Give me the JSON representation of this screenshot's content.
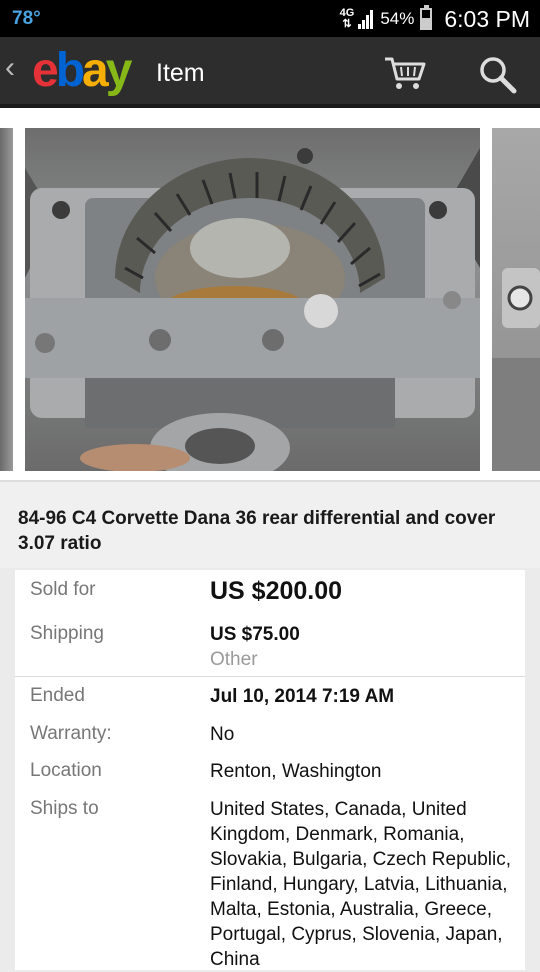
{
  "status_bar": {
    "temperature": "78°",
    "network": "4G",
    "battery_percent": "54%",
    "battery_level": 0.54,
    "time": "6:03 PM"
  },
  "app_bar": {
    "back_icon": "chevron-left-icon",
    "logo": "ebay",
    "title": "Item",
    "cart_icon": "cart-icon",
    "search_icon": "search-icon",
    "background_color": "#2d2d2d"
  },
  "gallery": {
    "images": [
      "previous-photo",
      "differential-photo",
      "next-photo"
    ]
  },
  "item": {
    "title": "84-96 C4 Corvette Dana 36 rear differential and cover 3.07 ratio"
  },
  "details": {
    "sold_for_label": "Sold for",
    "sold_for_value": "US $200.00",
    "shipping_label": "Shipping",
    "shipping_value": "US $75.00",
    "shipping_method": "Other",
    "ended_label": "Ended",
    "ended_value": "Jul 10, 2014 7:19 AM",
    "warranty_label": "Warranty:",
    "warranty_value": "No",
    "location_label": "Location",
    "location_value": "Renton, Washington",
    "ships_to_label": "Ships to",
    "ships_to_value": "United States, Canada, United Kingdom, Denmark, Romania, Slovakia, Bulgaria, Czech Republic, Finland, Hungary, Latvia, Lithuania, Malta, Estonia, Australia, Greece, Portugal, Cyprus, Slovenia, Japan, China"
  }
}
